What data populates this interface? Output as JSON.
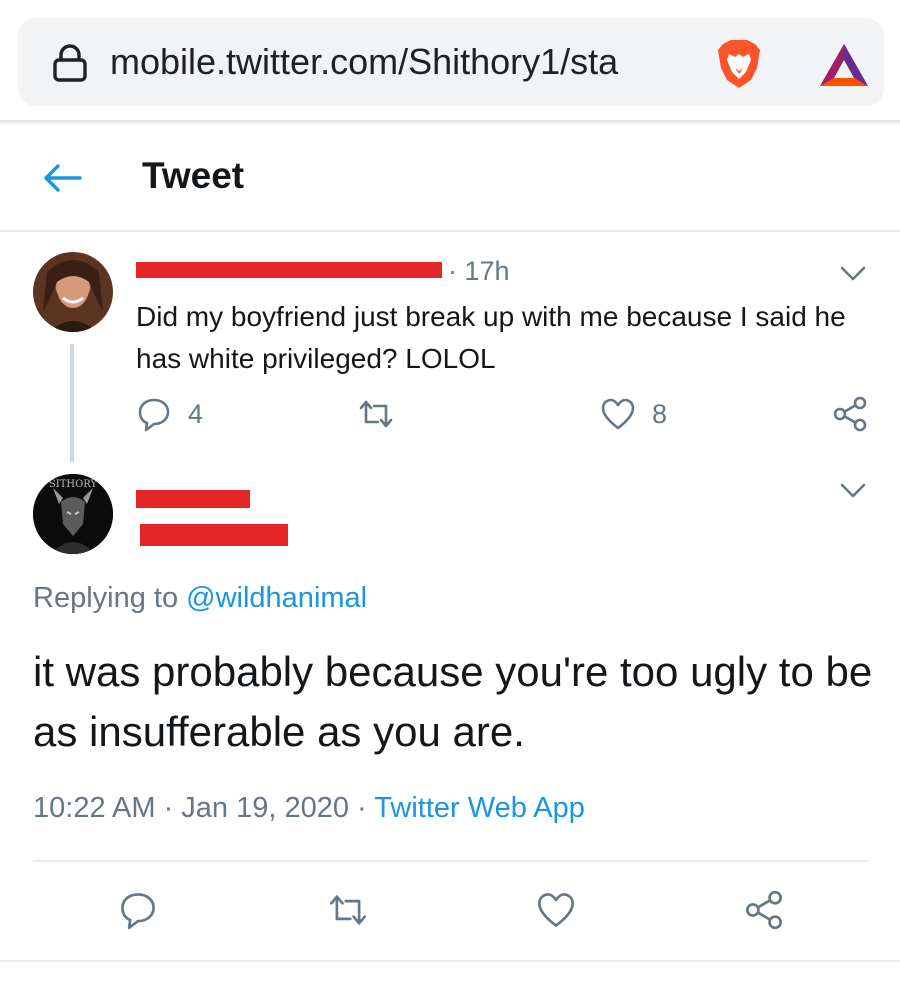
{
  "browser": {
    "url": "mobile.twitter.com/Shithory1/sta",
    "icons": [
      "lock-icon",
      "brave-lion-icon",
      "bat-triangle-icon"
    ]
  },
  "header": {
    "title": "Tweet",
    "back_icon": "back-arrow-icon"
  },
  "parent_tweet": {
    "time": "· 17h",
    "text": "Did my boyfriend just break up with me because I said he has white privileged? LOLOL",
    "reply_count": "4",
    "like_count": "8",
    "icons": [
      "reply-icon",
      "retweet-icon",
      "like-icon",
      "share-icon",
      "chevron-down-icon"
    ]
  },
  "main_tweet": {
    "replying_prefix": "Replying to",
    "replying_handle": "@wildhanimal",
    "avatar_text": "SITHORY",
    "text": "it was probably because you're too ugly to be as insufferable as you are.",
    "timestamp": "10:22 AM · Jan 19, 2020 ·",
    "source": "Twitter Web App",
    "icons": [
      "reply-icon",
      "retweet-icon",
      "like-icon",
      "share-icon",
      "chevron-down-icon"
    ]
  },
  "colors": {
    "accent": "#1b95e0",
    "secondary_text": "#657786",
    "redaction": "#e32526",
    "brave_orange": "#fb542b",
    "bat_purple": "#662d91"
  }
}
